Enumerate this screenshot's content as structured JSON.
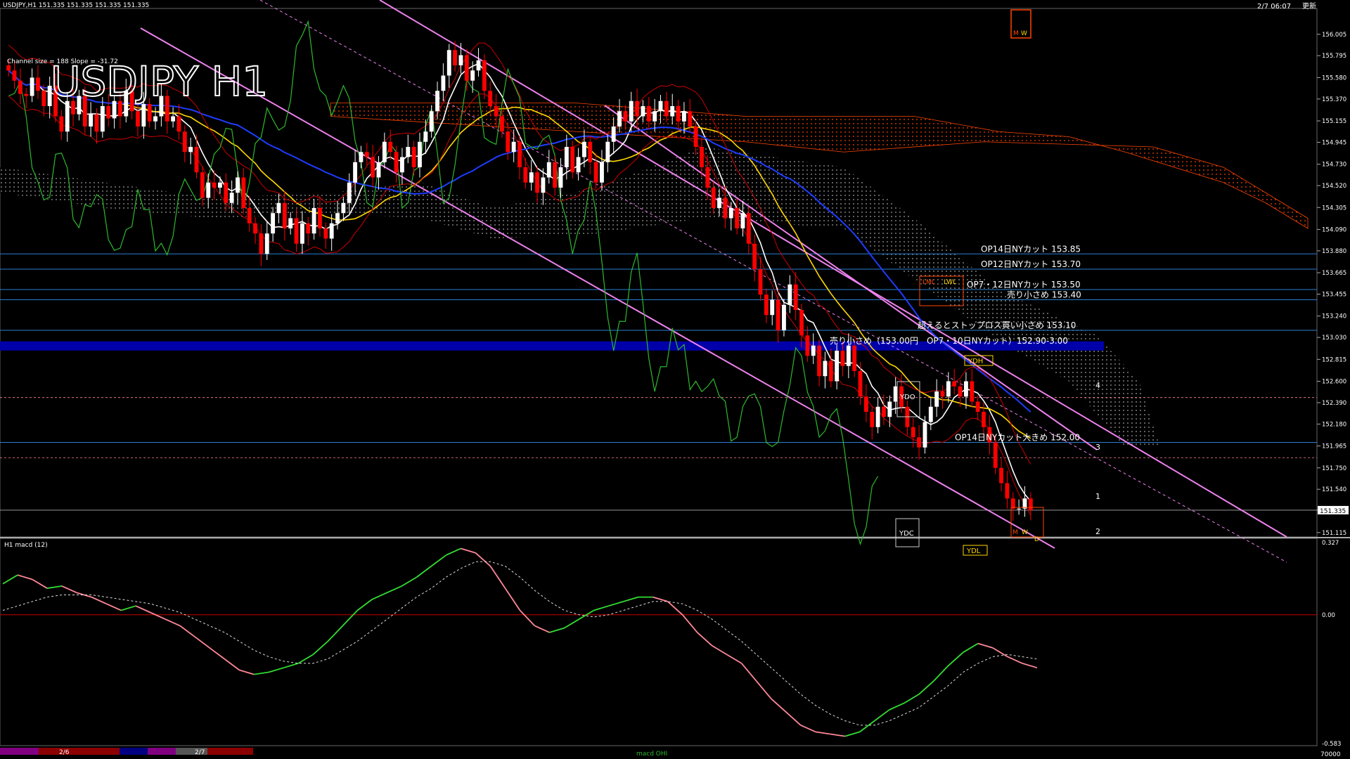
{
  "window": {
    "symbol_info": "USDJPY,H1  151.335 151.335 151.335 151.335",
    "title": "USDJPY H1",
    "channel_info": "Channel size = 188 Slope = -31.72",
    "time": "2/7 06:07",
    "clock_suffix": "更新",
    "ohlc_cut": "151.335"
  },
  "colors": {
    "background": "#000000",
    "bull": "#ffffff",
    "bear": "#ff0000",
    "kumo": "#ff4500",
    "channel": "#ee82ee",
    "ma_white": "#ffffff",
    "ma_yellow": "#ffd700",
    "ma_blue": "#1e3cff",
    "chikou": "#2eb82e",
    "macd_up": "#33dd33",
    "macd_down": "#ff8899",
    "hline": "#2a7fd4",
    "zone": "#0000aa"
  },
  "chart_data": [
    {
      "type": "candlestick",
      "pair": "USDJPY",
      "timeframe": "H1",
      "title": "USDJPY H1",
      "ylim": [
        151.1,
        156.1
      ],
      "y_ticks": [
        "156.005",
        "155.795",
        "155.580",
        "155.370",
        "155.155",
        "154.945",
        "154.730",
        "154.520",
        "154.305",
        "154.090",
        "153.880",
        "153.665",
        "153.455",
        "153.240",
        "153.030",
        "152.815",
        "152.600",
        "152.390",
        "152.180",
        "151.965",
        "151.750",
        "151.540",
        "151.335",
        "151.115"
      ],
      "current_price": "151.335",
      "x_labels": [
        "2/6",
        "2/7"
      ],
      "close": [
        155.65,
        155.55,
        155.42,
        155.4,
        155.58,
        155.45,
        155.3,
        155.5,
        155.2,
        155.05,
        155.35,
        155.22,
        155.4,
        155.1,
        155.22,
        155.05,
        155.3,
        155.18,
        155.35,
        155.2,
        155.45,
        155.25,
        155.1,
        155.32,
        155.15,
        155.2,
        155.4,
        155.15,
        155.2,
        155.05,
        154.85,
        154.9,
        154.65,
        154.4,
        154.55,
        154.5,
        154.55,
        154.35,
        154.45,
        154.6,
        154.3,
        154.15,
        154.05,
        153.85,
        154.05,
        154.25,
        154.35,
        154.1,
        154.2,
        153.95,
        154.15,
        154.05,
        154.3,
        154.1,
        154.0,
        154.15,
        154.25,
        154.35,
        154.55,
        154.75,
        154.85,
        154.8,
        154.6,
        154.75,
        154.95,
        154.85,
        154.65,
        154.8,
        154.9,
        154.7,
        154.95,
        155.05,
        155.25,
        155.45,
        155.6,
        155.85,
        155.7,
        155.8,
        155.55,
        155.65,
        155.75,
        155.45,
        155.3,
        155.2,
        155.05,
        154.85,
        154.95,
        154.7,
        154.55,
        154.65,
        154.45,
        154.6,
        154.75,
        154.5,
        154.7,
        154.9,
        154.65,
        154.8,
        154.95,
        154.75,
        154.55,
        154.75,
        154.95,
        155.1,
        155.25,
        155.15,
        155.35,
        155.2,
        155.3,
        155.15,
        155.25,
        155.35,
        155.2,
        155.3,
        155.15,
        155.25,
        155.1,
        154.9,
        154.7,
        154.5,
        154.3,
        154.4,
        154.2,
        154.3,
        154.1,
        154.25,
        153.95,
        153.7,
        153.45,
        153.25,
        153.4,
        153.1,
        153.35,
        153.55,
        153.3,
        153.05,
        152.85,
        152.95,
        152.65,
        152.8,
        152.6,
        152.9,
        152.75,
        152.95,
        152.7,
        152.45,
        152.3,
        152.15,
        152.35,
        152.25,
        152.4,
        152.55,
        152.35,
        152.15,
        152.05,
        151.95,
        152.2,
        152.35,
        152.5,
        152.45,
        152.6,
        152.55,
        152.45,
        152.6,
        152.4,
        152.3,
        152.15,
        152.0,
        151.75,
        151.6,
        151.45,
        151.35,
        151.35,
        151.45,
        151.335
      ],
      "levels": [
        {
          "price": 153.85,
          "label": "OP14日NYカット 153.85"
        },
        {
          "price": 153.7,
          "label": "OP12日NYカット 153.70"
        },
        {
          "price": 153.5,
          "label": "OP7・12日NYカット 153.50"
        },
        {
          "price": 153.4,
          "label": "売り小さめ 153.40"
        },
        {
          "price": 153.1,
          "label": "超えるとストップロス買い小さめ 153.10"
        },
        {
          "price": 152.95,
          "label": "売り小さめ（153.00円　OP7・10日NYカット）152.90-3.00"
        },
        {
          "price": 152.0,
          "label": "OP14日NYカット大きめ 152.00"
        }
      ],
      "dotted_levels": [
        152.44,
        151.85
      ],
      "markers": {
        "ydo": "YDO",
        "ydc": "YDC",
        "ydl": "YDL",
        "lml": "LML",
        "lwl": "LWL",
        "m": "M",
        "w": "W",
        "d": "D",
        "ydh": "YDH"
      },
      "channel_numbers": [
        "4",
        "3",
        "1",
        "2"
      ],
      "overlays": [
        "Ichimoku kumo",
        "moving averages",
        "Bollinger bands",
        "regression channel"
      ]
    },
    {
      "type": "line",
      "indicator": "H1  macd (12)",
      "title": "H1  macd (12)",
      "ylim": [
        -0.583,
        0.327
      ],
      "y_ticks": [
        "0.327",
        "0.00",
        "-0.583"
      ],
      "series": [
        {
          "name": "macd",
          "values": [
            0.14,
            0.18,
            0.16,
            0.12,
            0.13,
            0.1,
            0.08,
            0.05,
            0.02,
            0.04,
            0.01,
            -0.02,
            -0.05,
            -0.1,
            -0.15,
            -0.2,
            -0.25,
            -0.27,
            -0.26,
            -0.24,
            -0.22,
            -0.18,
            -0.12,
            -0.05,
            0.02,
            0.07,
            0.1,
            0.13,
            0.17,
            0.22,
            0.27,
            0.3,
            0.28,
            0.22,
            0.12,
            0.02,
            -0.05,
            -0.08,
            -0.06,
            -0.02,
            0.02,
            0.04,
            0.06,
            0.08,
            0.08,
            0.06,
            0.0,
            -0.08,
            -0.14,
            -0.18,
            -0.22,
            -0.3,
            -0.38,
            -0.44,
            -0.5,
            -0.53,
            -0.54,
            -0.55,
            -0.53,
            -0.48,
            -0.43,
            -0.4,
            -0.36,
            -0.3,
            -0.23,
            -0.17,
            -0.13,
            -0.15,
            -0.19,
            -0.22,
            -0.24
          ]
        },
        {
          "name": "signal",
          "values": [
            0.02,
            0.04,
            0.06,
            0.08,
            0.09,
            0.09,
            0.09,
            0.08,
            0.07,
            0.06,
            0.05,
            0.03,
            0.01,
            -0.02,
            -0.05,
            -0.08,
            -0.12,
            -0.16,
            -0.19,
            -0.21,
            -0.22,
            -0.22,
            -0.2,
            -0.16,
            -0.12,
            -0.07,
            -0.02,
            0.03,
            0.08,
            0.12,
            0.17,
            0.21,
            0.24,
            0.24,
            0.22,
            0.17,
            0.11,
            0.06,
            0.02,
            0.0,
            -0.01,
            0.0,
            0.02,
            0.04,
            0.06,
            0.06,
            0.05,
            0.02,
            -0.02,
            -0.07,
            -0.12,
            -0.18,
            -0.24,
            -0.3,
            -0.36,
            -0.41,
            -0.45,
            -0.48,
            -0.5,
            -0.5,
            -0.48,
            -0.45,
            -0.42,
            -0.37,
            -0.32,
            -0.26,
            -0.22,
            -0.19,
            -0.18,
            -0.19,
            -0.2
          ]
        }
      ],
      "bottom_scale": "70000",
      "footer_label": "macd OHI"
    }
  ]
}
